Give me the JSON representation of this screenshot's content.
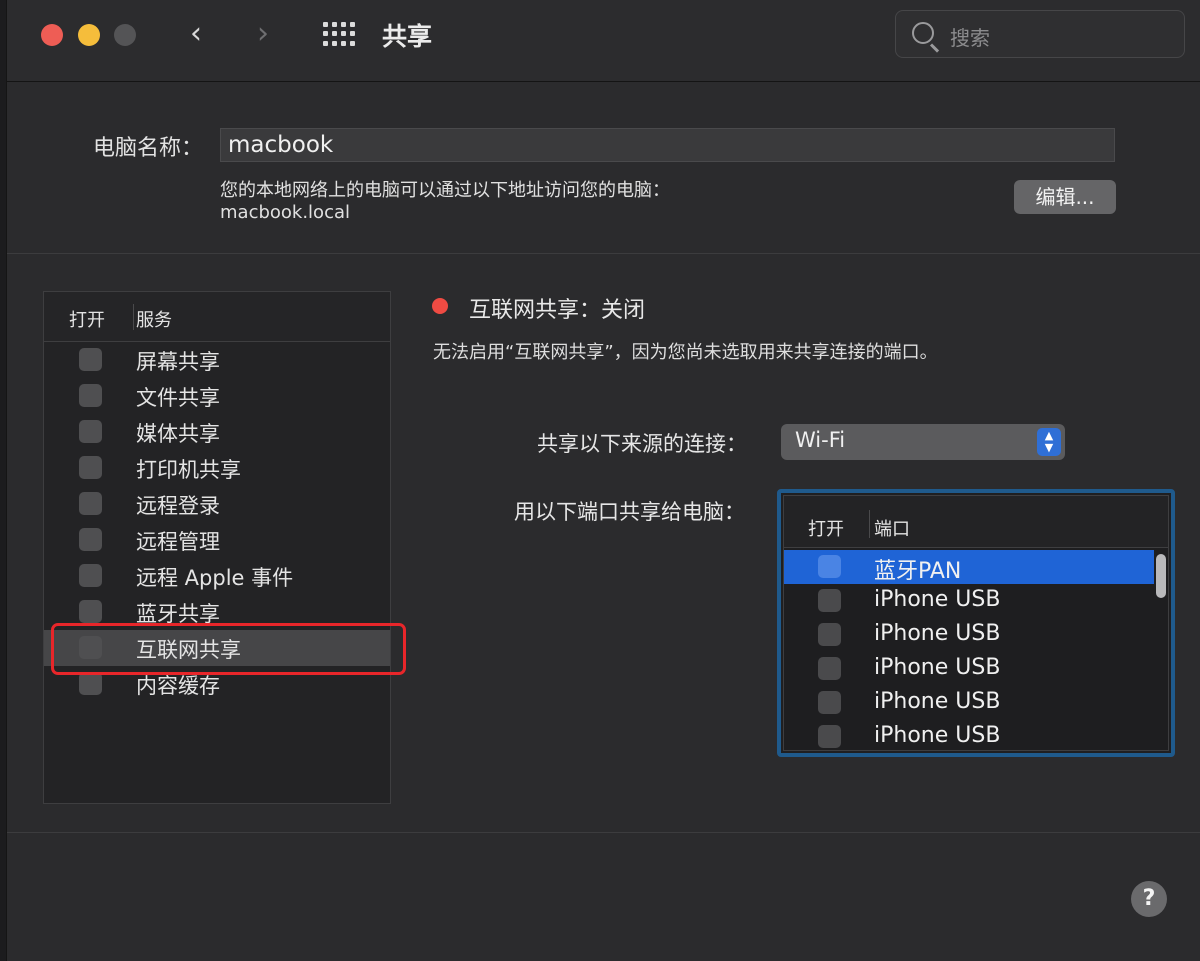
{
  "window": {
    "title": "共享",
    "nav_back": "‹",
    "nav_forward": "›",
    "search_placeholder": "搜索"
  },
  "computer": {
    "name_label": "电脑名称：",
    "name_value": "macbook",
    "address_desc": "您的本地网络上的电脑可以通过以下地址访问您的电脑：",
    "address_host": "macbook.local",
    "edit_button": "编辑..."
  },
  "services": {
    "header_on": "打开",
    "header_service": "服务",
    "items": [
      {
        "label": "屏幕共享",
        "checked": false
      },
      {
        "label": "文件共享",
        "checked": false
      },
      {
        "label": "媒体共享",
        "checked": false
      },
      {
        "label": "打印机共享",
        "checked": false
      },
      {
        "label": "远程登录",
        "checked": false
      },
      {
        "label": "远程管理",
        "checked": false
      },
      {
        "label": "远程 Apple 事件",
        "checked": false
      },
      {
        "label": "蓝牙共享",
        "checked": false
      },
      {
        "label": "互联网共享",
        "checked": false,
        "selected": true
      },
      {
        "label": "内容缓存",
        "checked": false
      }
    ]
  },
  "internet_sharing": {
    "status": "互联网共享：关闭",
    "status_color": "#ef4b43",
    "description": "无法启用“互联网共享”，因为您尚未选取用来共享连接的端口。",
    "share_from_label": "共享以下来源的连接：",
    "share_from_value": "Wi-Fi",
    "ports_label": "用以下端口共享给电脑：",
    "ports_header_on": "打开",
    "ports_header_port": "端口",
    "ports": [
      {
        "label": "蓝牙PAN",
        "checked": false,
        "selected": true
      },
      {
        "label": "iPhone USB",
        "checked": false
      },
      {
        "label": "iPhone USB",
        "checked": false
      },
      {
        "label": "iPhone USB",
        "checked": false
      },
      {
        "label": "iPhone USB",
        "checked": false
      },
      {
        "label": "iPhone USB",
        "checked": false
      }
    ]
  },
  "help_button": "?",
  "colors": {
    "accent": "#1f64d6",
    "highlight_box": "#e8262a"
  }
}
